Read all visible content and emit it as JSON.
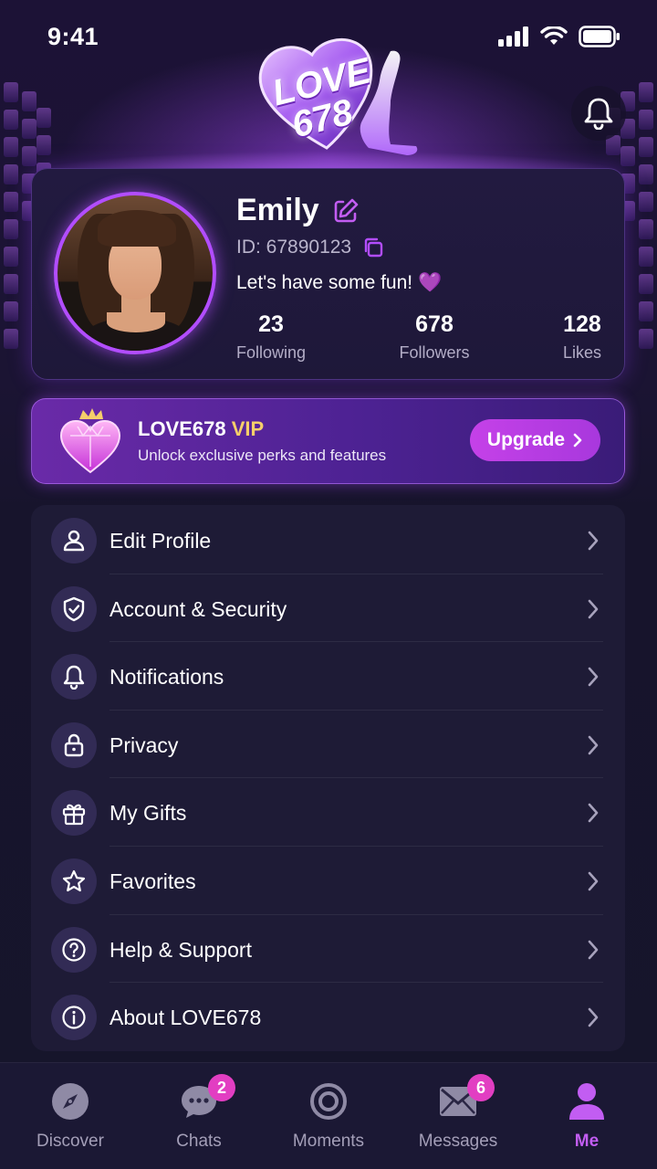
{
  "status_bar": {
    "time": "9:41"
  },
  "logo": {
    "line1": "LOVE",
    "line2": "678"
  },
  "profile": {
    "name": "Emily",
    "id_text": "ID: 67890123",
    "bio": "Let's have some fun! 💜",
    "stats": [
      {
        "value": "23",
        "label": "Following"
      },
      {
        "value": "678",
        "label": "Followers"
      },
      {
        "value": "128",
        "label": "Likes"
      }
    ]
  },
  "vip": {
    "title_prefix": "LOVE678",
    "title_highlight": "VIP",
    "subtitle": "Unlock exclusive perks and features",
    "button_label": "Upgrade",
    "highlight_color": "#f6cf6a"
  },
  "menu": [
    {
      "label": "Edit Profile",
      "icon": "user-icon"
    },
    {
      "label": "Account & Security",
      "icon": "shield-icon"
    },
    {
      "label": "Notifications",
      "icon": "bell-icon"
    },
    {
      "label": "Privacy",
      "icon": "lock-icon"
    },
    {
      "label": "My Gifts",
      "icon": "gift-icon"
    },
    {
      "label": "Favorites",
      "icon": "star-icon"
    },
    {
      "label": "Help & Support",
      "icon": "help-icon"
    },
    {
      "label": "About LOVE678",
      "icon": "info-icon"
    }
  ],
  "tabs": [
    {
      "label": "Discover",
      "icon": "compass-icon",
      "badge": ""
    },
    {
      "label": "Chats",
      "icon": "chat-icon",
      "badge": "2"
    },
    {
      "label": "Moments",
      "icon": "moments-icon",
      "badge": ""
    },
    {
      "label": "Messages",
      "icon": "mail-icon",
      "badge": "6"
    },
    {
      "label": "Me",
      "icon": "person-icon",
      "badge": "",
      "active": true
    }
  ],
  "colors": {
    "accent": "#b24dff",
    "active_tab": "#c25df2",
    "badge": "#e23ec2"
  }
}
